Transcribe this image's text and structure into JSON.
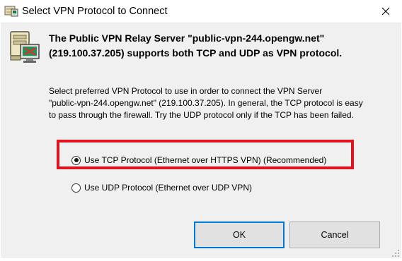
{
  "window": {
    "title": "Select VPN Protocol to Connect",
    "close_label": "✕"
  },
  "dialog": {
    "heading_line1": "The Public VPN Relay Server \"public-vpn-244.opengw.net\"",
    "heading_line2": "(219.100.37.205) supports both TCP and UDP as VPN protocol.",
    "description_line1": "Select preferred VPN Protocol to use in order to connect the VPN Server",
    "description_line2": "\"public-vpn-244.opengw.net\" (219.100.37.205). In general, the TCP protocol is easy",
    "description_line3": "to pass through the firewall. Try the UDP protocol only if the TCP has been failed.",
    "options": [
      {
        "label": "Use TCP Protocol (Ethernet over HTTPS VPN) (Recommended)",
        "selected": true
      },
      {
        "label": "Use UDP Protocol (Ethernet over UDP VPN)",
        "selected": false
      }
    ],
    "ok_label": "OK",
    "cancel_label": "Cancel"
  },
  "colors": {
    "highlight": "#e0141e",
    "dialog_bg": "#f0f0f0",
    "default_button_border": "#0078d7"
  },
  "icons": {
    "title": "vpn-server-icon",
    "dialog": "vpn-server-computer-icon",
    "close": "close-icon"
  }
}
